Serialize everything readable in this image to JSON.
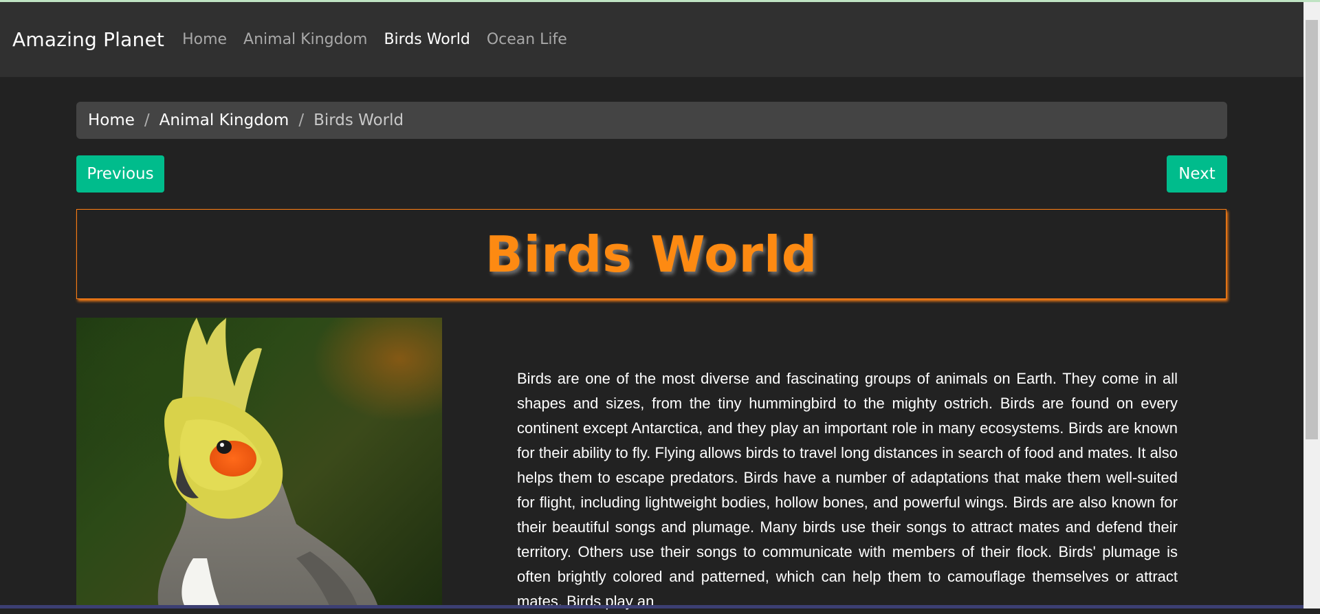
{
  "navbar": {
    "brand": "Amazing Planet",
    "links": [
      {
        "label": "Home",
        "active": false
      },
      {
        "label": "Animal Kingdom",
        "active": false
      },
      {
        "label": "Birds World",
        "active": true
      },
      {
        "label": "Ocean Life",
        "active": false
      }
    ]
  },
  "breadcrumb": {
    "items": [
      "Home",
      "Animal Kingdom"
    ],
    "separator": "/",
    "current": "Birds World"
  },
  "pager": {
    "previous_label": "Previous",
    "next_label": "Next"
  },
  "page": {
    "title": "Birds World",
    "image_subject": "cockatiel",
    "body": "Birds are one of the most diverse and fascinating groups of animals on Earth. They come in all shapes and sizes, from the tiny hummingbird to the mighty ostrich. Birds are found on every continent except Antarctica, and they play an important role in many ecosystems. Birds are known for their ability to fly. Flying allows birds to travel long distances in search of food and mates. It also helps them to escape predators. Birds have a number of adaptations that make them well-suited for flight, including lightweight bodies, hollow bones, and powerful wings. Birds are also known for their beautiful songs and plumage. Many birds use their songs to attract mates and defend their territory. Others use their songs to communicate with members of their flock. Birds' plumage is often brightly colored and patterned, which can help them to camouflage themselves or attract mates. Birds play an"
  },
  "colors": {
    "background": "#222222",
    "navbar": "#303030",
    "accent_button": "#00bc8c",
    "title_orange": "#fd7e14",
    "breadcrumb_bg": "#444444"
  }
}
